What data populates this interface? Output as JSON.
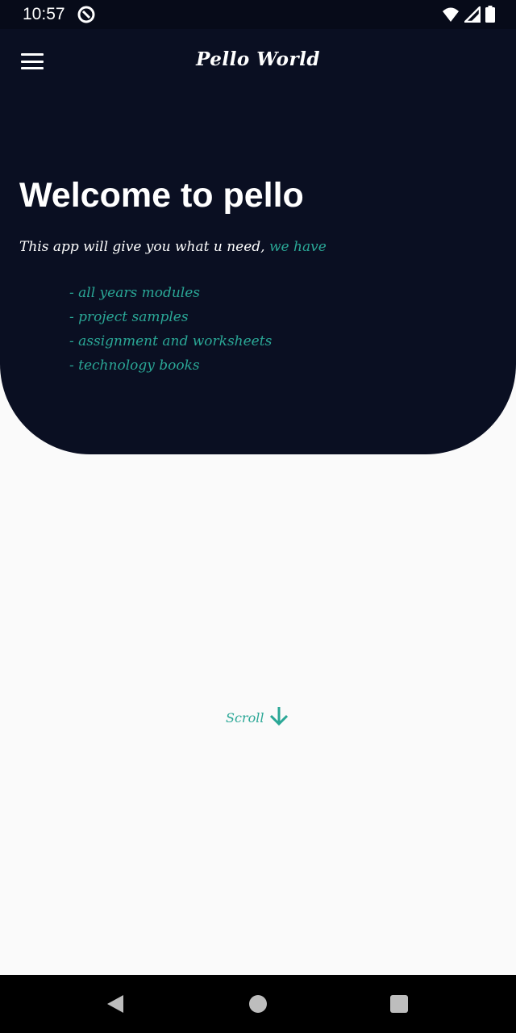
{
  "status_bar": {
    "time": "10:57",
    "icons": [
      "app-notification-icon",
      "wifi-icon",
      "signal-icon",
      "battery-icon"
    ]
  },
  "toolbar": {
    "title": "Pello World",
    "menu_icon": "hamburger-menu-icon"
  },
  "hero": {
    "title": "Welcome to pello",
    "intro_text": "This app will give you what u need,",
    "intro_accent": "we have",
    "features": [
      "- all years modules",
      "- project samples",
      "- assignment and worksheets",
      "- technology books"
    ]
  },
  "scroll_hint": {
    "label": "Scroll",
    "icon": "arrow-down-icon"
  },
  "nav_bar": {
    "icons": [
      "back-icon",
      "home-icon",
      "recents-icon"
    ]
  },
  "colors": {
    "hero_bg": "#0a0f22",
    "status_bg": "#070b19",
    "accent": "#2aa796",
    "page_bg": "#fafafa"
  }
}
